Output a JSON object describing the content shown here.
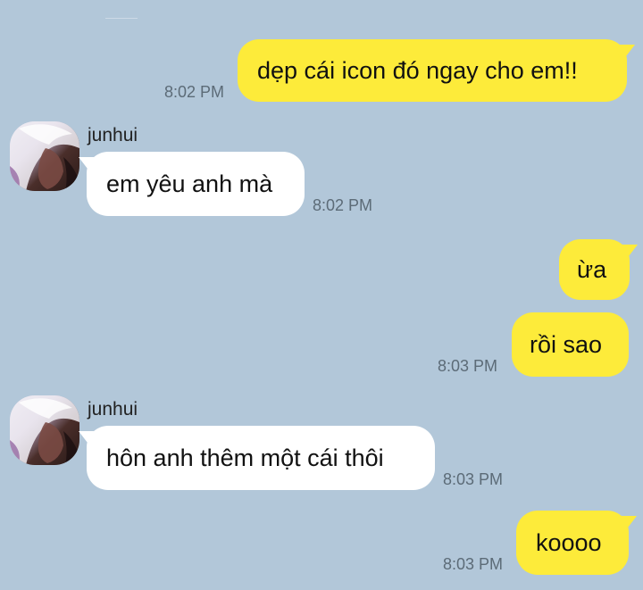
{
  "messages": [
    {
      "side": "me",
      "text": "dẹp cái icon đó ngay cho em!!",
      "time": "8:02 PM"
    },
    {
      "side": "them",
      "sender": "junhui",
      "text": "em yêu anh mà",
      "time": "8:02 PM"
    },
    {
      "side": "me",
      "text": "ừa",
      "time": ""
    },
    {
      "side": "me",
      "text": "rồi sao",
      "time": "8:03 PM"
    },
    {
      "side": "them",
      "sender": "junhui",
      "text": "hôn anh thêm một cái thôi",
      "time": "8:03 PM"
    },
    {
      "side": "me",
      "text": "koooo",
      "time": "8:03 PM"
    }
  ],
  "colors": {
    "background": "#b2c7d9",
    "my_bubble": "#fdeb3a",
    "their_bubble": "#ffffff"
  }
}
